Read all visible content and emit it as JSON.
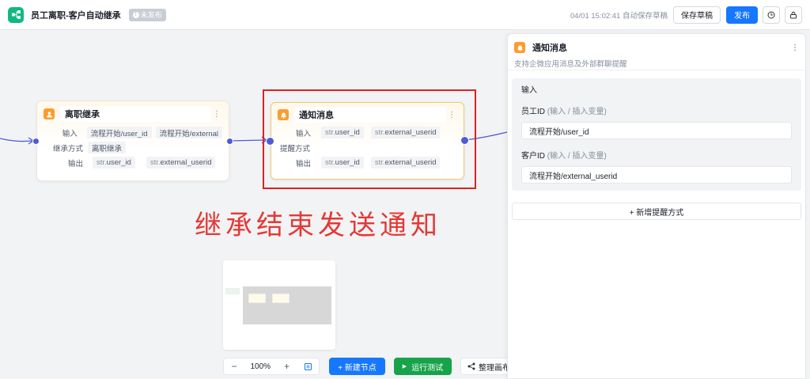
{
  "header": {
    "title": "员工离职-客户自动继承",
    "status_icon": "!",
    "status": "未发布",
    "autosave": "04/01 15:02:41 自动保存草稿",
    "save_draft_label": "保存草稿",
    "publish_label": "发布",
    "history_icon": "clock-icon",
    "lock_icon": "lock-icon"
  },
  "nodes": {
    "resign": {
      "title": "离职继承",
      "more": "⋮",
      "input_label": "输入",
      "input_tags": [
        "流程开始/user_id",
        "流程开始/external"
      ],
      "method_label": "继承方式",
      "method_tag": "离职继承",
      "output_label": "输出",
      "output_tags": [
        {
          "type": "str.",
          "name": "user_id"
        },
        {
          "type": "str.",
          "name": "external_userid"
        }
      ]
    },
    "notify": {
      "title": "通知消息",
      "more": "⋮",
      "input_label": "输入",
      "input_tags": [
        {
          "type": "str.",
          "name": "user_id"
        },
        {
          "type": "str.",
          "name": "external_userid"
        }
      ],
      "remind_label": "提醒方式",
      "output_label": "输出",
      "output_tags": [
        {
          "type": "str.",
          "name": "user_id"
        },
        {
          "type": "str.",
          "name": "external_userid"
        }
      ]
    }
  },
  "annotation": "继承结束发送通知",
  "canvas_toolbar": {
    "zoom_out": "−",
    "zoom_value": "100%",
    "zoom_in": "+",
    "new_node_label": "+ 新建节点",
    "run_test_label": "运行测试",
    "tidy_label": "整理画布"
  },
  "panel": {
    "title": "通知消息",
    "more": "⋮",
    "description": "支持企微应用消息及外部群聊提醒",
    "section_label": "输入",
    "fields": [
      {
        "label": "员工ID",
        "hint": " (输入 / 插入变量)",
        "value": "流程开始/user_id"
      },
      {
        "label": "客户ID",
        "hint": " (输入 / 插入变量)",
        "value": "流程开始/external_userid"
      }
    ],
    "add_reminder_label": "+  新增提醒方式"
  },
  "colors": {
    "accent": "#1677ff",
    "run": "#16a34a",
    "node_icon": "#ff9a2e",
    "edge": "#4e5bd6",
    "highlight": "#e02020",
    "annotation": "#e53935"
  }
}
